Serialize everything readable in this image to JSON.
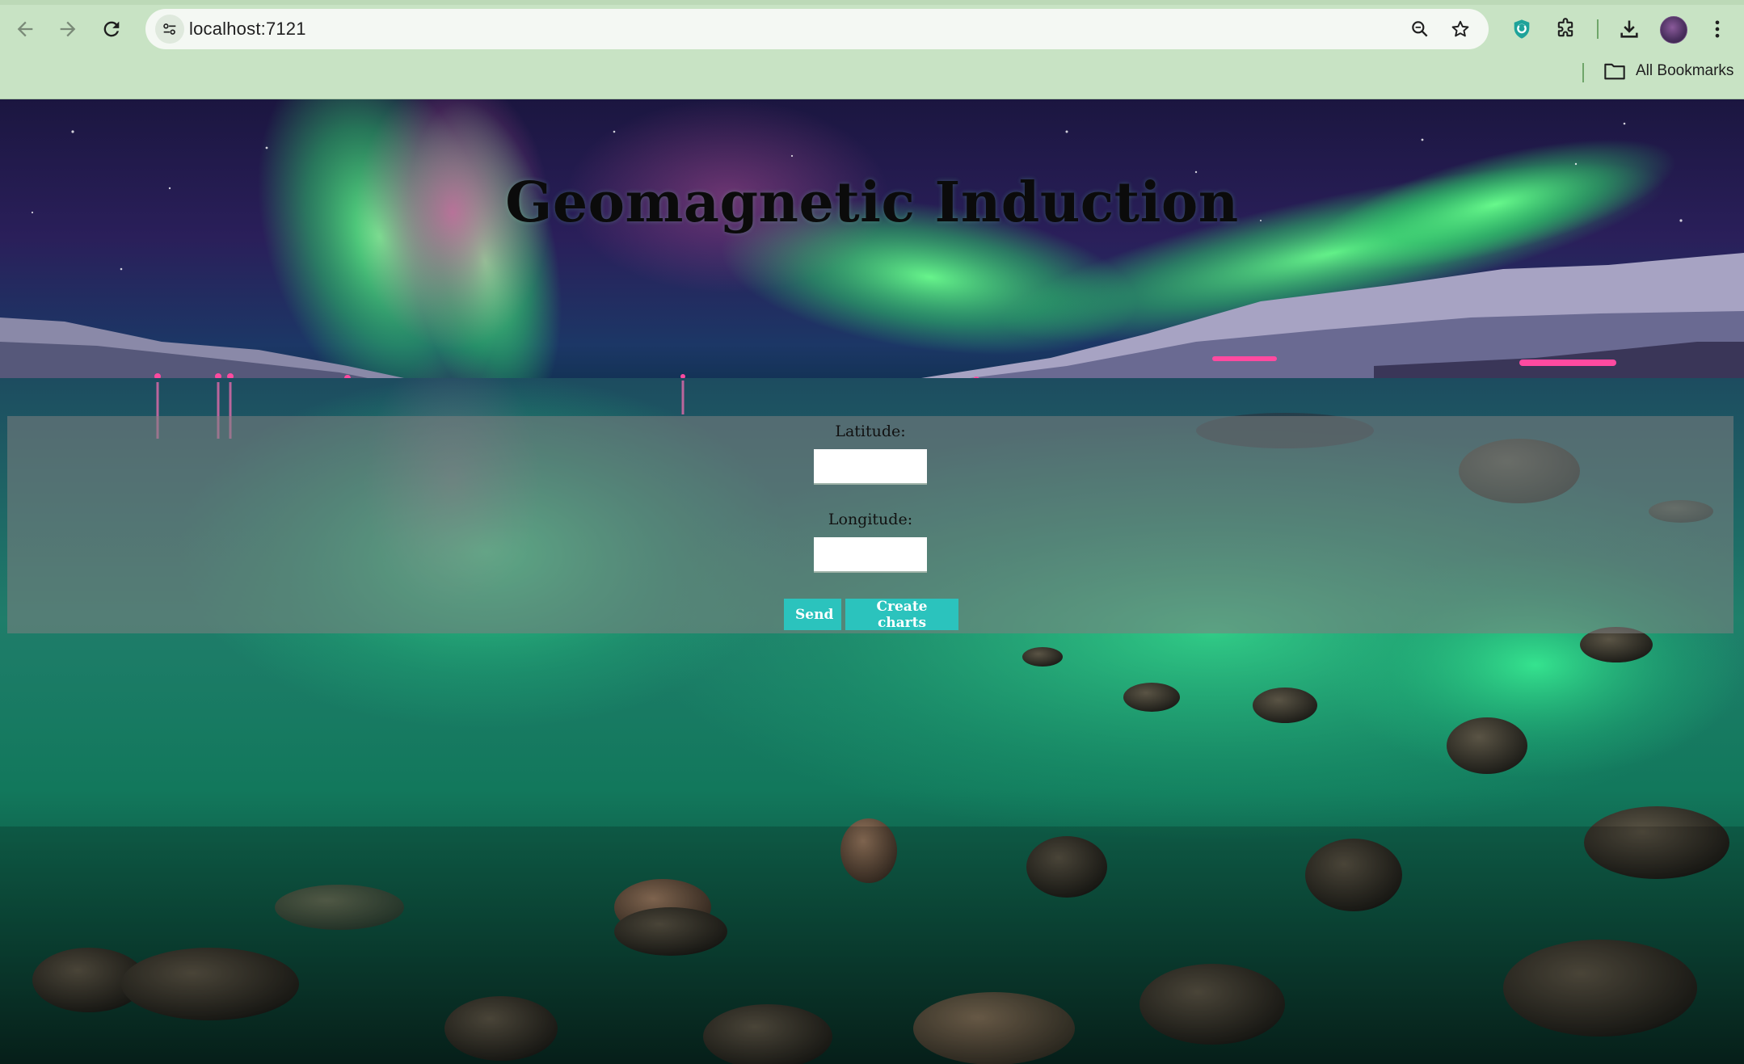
{
  "browser": {
    "url": "localhost:7121",
    "bookmarks_label": "All Bookmarks",
    "icons": {
      "back": "arrow-left-icon",
      "forward": "arrow-right-icon",
      "reload": "reload-icon",
      "site_info": "tune-icon",
      "zoom": "magnifier-icon",
      "bookmark": "star-icon",
      "extension_shield": "shield-extension-icon",
      "extensions": "puzzle-icon",
      "downloads": "download-icon",
      "profile": "avatar",
      "menu": "more-vert-icon",
      "folder": "folder-icon"
    },
    "chrome_color": "#c8e3c4"
  },
  "page": {
    "title": "Geomagnetic Induction",
    "background": "aurora borealis over lake with rocky shore",
    "form": {
      "latitude_label": "Latitude:",
      "latitude_value": "",
      "longitude_label": "Longitude:",
      "longitude_value": "",
      "send_label": "Send",
      "create_charts_label": "Create charts",
      "button_color": "#2bc3bd"
    }
  }
}
